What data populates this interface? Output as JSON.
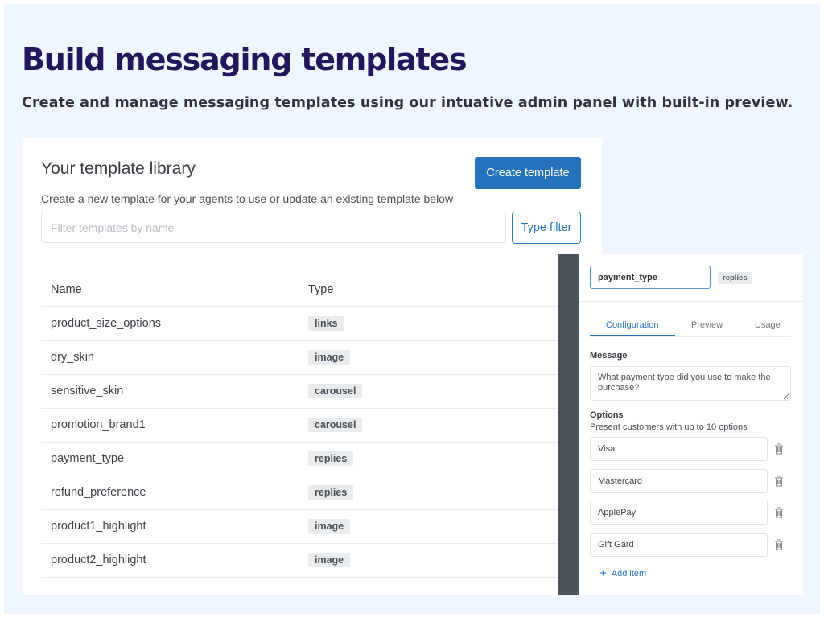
{
  "hero": {
    "title": "Build messaging templates",
    "subtitle": "Create and manage messaging templates using our intuative admin panel with built-in preview."
  },
  "library": {
    "title": "Your template library",
    "description": "Create a new template for your agents to use or update an existing template below",
    "create_button": "Create template",
    "filter_placeholder": "Filter templates by name",
    "filter_value": "",
    "type_filter_button": "Type filter",
    "columns": [
      "Name",
      "Type"
    ],
    "rows": [
      {
        "name": "product_size_options",
        "type": "links"
      },
      {
        "name": "dry_skin",
        "type": "image"
      },
      {
        "name": "sensitive_skin",
        "type": "carousel"
      },
      {
        "name": "promotion_brand1",
        "type": "carousel"
      },
      {
        "name": "payment_type",
        "type": "replies"
      },
      {
        "name": "refund_preference",
        "type": "replies"
      },
      {
        "name": "product1_highlight",
        "type": "image"
      },
      {
        "name": "product2_highlight",
        "type": "image"
      }
    ]
  },
  "editor": {
    "name_value": "payment_type",
    "type_badge": "replies",
    "tabs": [
      {
        "label": "Configuration",
        "active": true
      },
      {
        "label": "Preview",
        "active": false
      },
      {
        "label": "Usage",
        "active": false
      }
    ],
    "message_label": "Message",
    "message_value": "What payment type did you use to make the purchase?",
    "options_label": "Options",
    "options_help": "Present customers with up to 10 options",
    "options": [
      "Visa",
      "Mastercard",
      "ApplePay",
      "Gift Gard"
    ],
    "trash_icon": "trash-icon",
    "add_item_label": "Add item",
    "add_icon": "plus-icon"
  },
  "colors": {
    "accent": "#2673bb",
    "title": "#22175a",
    "background": "#eff6ff"
  }
}
